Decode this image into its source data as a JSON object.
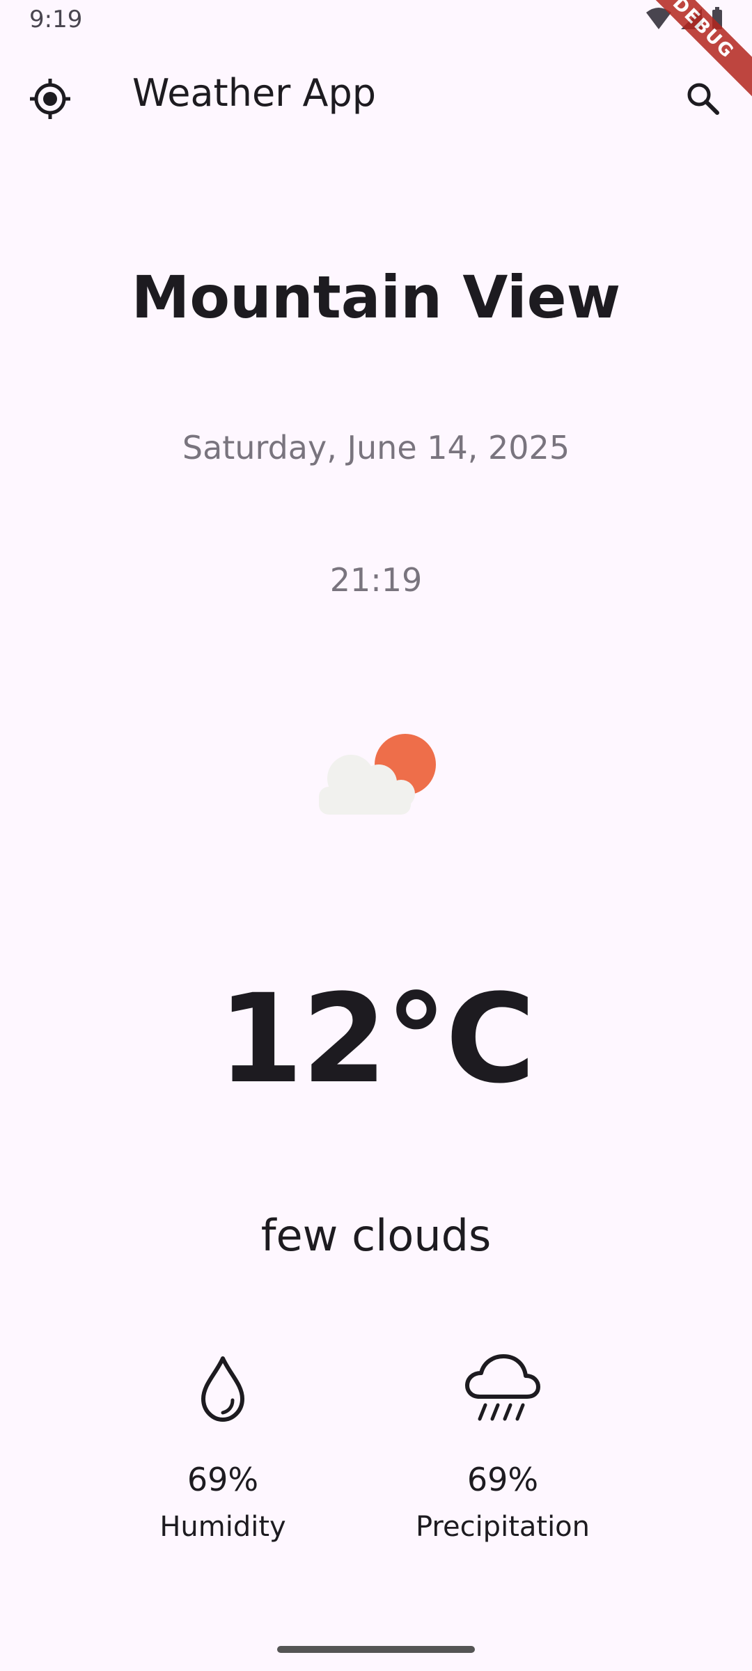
{
  "status_bar": {
    "time": "9:19",
    "debug_label": "DEBUG"
  },
  "app_bar": {
    "title": "Weather App",
    "locate_icon": "gps-fixed-icon",
    "search_icon": "search-icon"
  },
  "weather": {
    "city": "Mountain View",
    "date": "Saturday, June 14, 2025",
    "time": "21:19",
    "icon": "partly-cloudy-icon",
    "temperature": "12°C",
    "condition": "few clouds"
  },
  "stats": [
    {
      "icon": "water-drop-icon",
      "value": "69%",
      "label": "Humidity"
    },
    {
      "icon": "rain-cloud-icon",
      "value": "69%",
      "label": "Precipitation"
    }
  ],
  "colors": {
    "background": "#FEF7FF",
    "text": "#1D1B20",
    "muted": "#79747E",
    "sun": "#EE6E4A",
    "cloud": "#F1F1EE"
  }
}
